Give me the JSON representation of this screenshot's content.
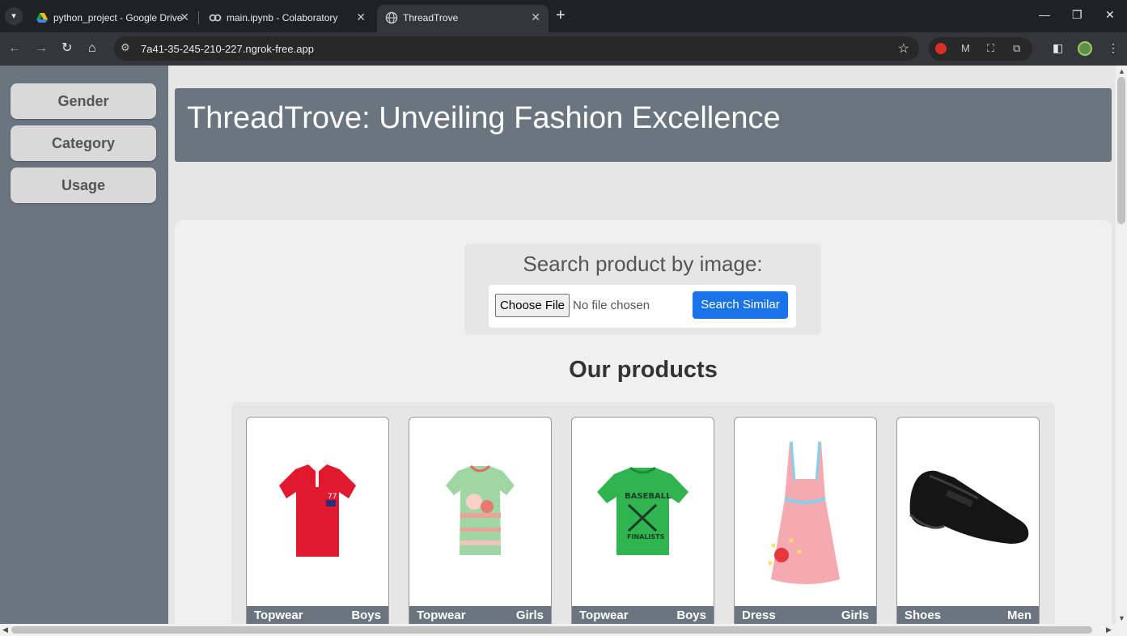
{
  "browser": {
    "tabs": [
      {
        "title": "python_project - Google Drive",
        "icon": "google-drive-icon"
      },
      {
        "title": "main.ipynb - Colaboratory",
        "icon": "colab-icon"
      },
      {
        "title": "ThreadTrove",
        "icon": "globe-icon",
        "active": true
      }
    ],
    "url": "7a41-35-245-210-227.ngrok-free.app"
  },
  "sidebar": {
    "items": [
      {
        "label": "Gender"
      },
      {
        "label": "Category"
      },
      {
        "label": "Usage"
      }
    ]
  },
  "header": {
    "title": "ThreadTrove: Unveiling Fashion Excellence"
  },
  "search": {
    "heading": "Search product by image:",
    "choose_label": "Choose File",
    "file_status": "No file chosen",
    "submit_label": "Search Similar"
  },
  "products": {
    "heading": "Our products",
    "items": [
      {
        "category": "Topwear",
        "gender": "Boys",
        "image": "red-polo-shirt"
      },
      {
        "category": "Topwear",
        "gender": "Girls",
        "image": "green-floral-tshirt"
      },
      {
        "category": "Topwear",
        "gender": "Boys",
        "image": "green-baseball-tshirt"
      },
      {
        "category": "Dress",
        "gender": "Girls",
        "image": "pink-dress"
      },
      {
        "category": "Shoes",
        "gender": "Men",
        "image": "black-formal-shoe"
      }
    ]
  },
  "colors": {
    "sidebar_bg": "#6b757f",
    "page_bg": "#e6e6e6",
    "accent": "#1a73e8"
  }
}
